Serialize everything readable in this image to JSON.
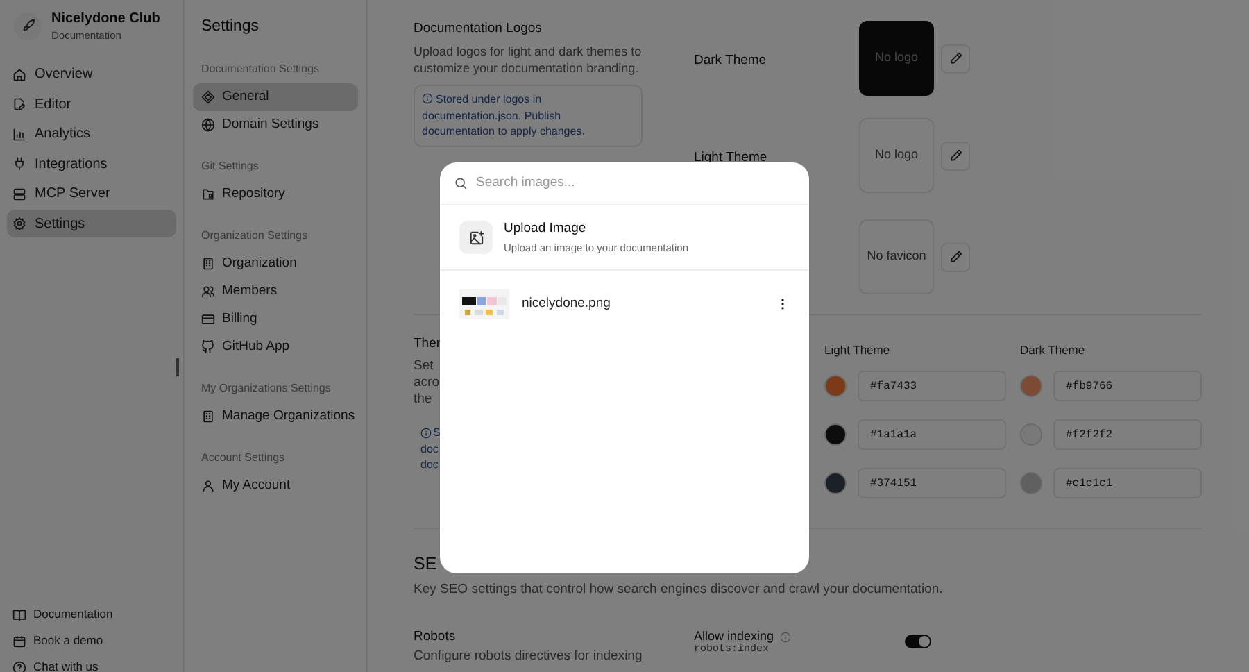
{
  "sidebar": {
    "brand": {
      "name": "Nicelydone Club",
      "subtitle": "Documentation"
    },
    "items": [
      {
        "label": "Overview",
        "selected": false
      },
      {
        "label": "Editor",
        "selected": false
      },
      {
        "label": "Analytics",
        "selected": false
      },
      {
        "label": "Integrations",
        "selected": false
      },
      {
        "label": "MCP Server",
        "selected": false
      },
      {
        "label": "Settings",
        "selected": true
      }
    ],
    "footer_links": [
      "Documentation",
      "Book a demo",
      "Chat with us"
    ]
  },
  "settings_nav": {
    "title": "Settings",
    "groups": [
      {
        "heading": "Documentation Settings",
        "items": [
          {
            "label": "General",
            "selected": true
          },
          {
            "label": "Domain Settings",
            "selected": false
          }
        ]
      },
      {
        "heading": "Git Settings",
        "items": [
          {
            "label": "Repository",
            "selected": false
          }
        ]
      },
      {
        "heading": "Organization Settings",
        "items": [
          {
            "label": "Organization",
            "selected": false
          },
          {
            "label": "Members",
            "selected": false
          },
          {
            "label": "Billing",
            "selected": false
          },
          {
            "label": "GitHub App",
            "selected": false
          }
        ]
      },
      {
        "heading": "My Organizations Settings",
        "items": [
          {
            "label": "Manage Organizations",
            "selected": false
          }
        ]
      },
      {
        "heading": "Account Settings",
        "items": [
          {
            "label": "My Account",
            "selected": false
          }
        ]
      }
    ]
  },
  "logos": {
    "title": "Documentation Logos",
    "description": "Upload logos for light and dark themes to customize your documentation branding.",
    "note": "Stored under logos in documentation.json. Publish documentation to apply changes.",
    "slots": [
      {
        "label": "Dark Theme",
        "placeholder": "No logo",
        "dark": true
      },
      {
        "placeholder": "No logo",
        "label": "Light Theme",
        "dark": false
      },
      {
        "placeholder": "No favicon",
        "dark": false
      }
    ]
  },
  "theme": {
    "title": "Ther",
    "description": [
      "Set",
      "acro",
      "the"
    ],
    "note": [
      "S",
      "doc",
      "doc"
    ],
    "columns": [
      {
        "heading": "Light Theme",
        "colors": [
          {
            "value": "#fa7433"
          },
          {
            "value": "#1a1a1a"
          },
          {
            "value": "#374151"
          }
        ]
      },
      {
        "heading": "Dark Theme",
        "colors": [
          {
            "value": "#fb9766"
          },
          {
            "value": "#f2f2f2"
          },
          {
            "value": "#c1c1c1"
          }
        ]
      }
    ]
  },
  "seo": {
    "title": "SE",
    "description": "Key SEO settings that control how search engines discover and crawl your documentation."
  },
  "robots": {
    "title": "Robots",
    "description": "Configure robots directives for indexing",
    "setting": "Allow indexing",
    "code": "robots:index",
    "on": true
  },
  "image_picker": {
    "search": {
      "placeholder": "Search images..."
    },
    "upload": {
      "title": "Upload Image",
      "subtitle": "Upload an image to your documentation"
    },
    "images": [
      {
        "name": "nicelydone.png"
      }
    ]
  }
}
